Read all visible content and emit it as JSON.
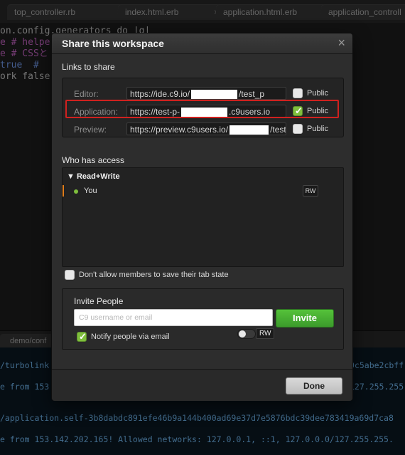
{
  "ide": {
    "tabs": [
      {
        "label": "top_controller.rb",
        "close": "×"
      },
      {
        "label": "index.html.erb",
        "close": "×"
      },
      {
        "label": "application.html.erb",
        "close": "×"
      },
      {
        "label": "application_controll",
        "close": ""
      }
    ],
    "code_lines": [
      "on.config.generators do |g|",
      "e # helpe",
      "e # CSSと",
      "true  #",
      "ork false"
    ],
    "terminal_tab": "demo/conf",
    "terminal_lines": [
      "/turbolink",
      "e from 153.",
      "/application.self-3b8dabdc891efe46b9a144b400ad69e37d7e5876bdc39dee783419a69d7ca8",
      "e from 153.142.202.165! Allowed networks: 127.0.0.1, ::1, 127.0.0.0/127.255.255."
    ],
    "terminal_right_fragments": [
      "0c5abe2cbff",
      "127.255.255."
    ]
  },
  "modal": {
    "title": "Share this workspace",
    "close": "×",
    "links_to_share": "Links to share",
    "links": [
      {
        "label": "Editor:",
        "url_prefix": "https://ide.c9.io/",
        "url_suffix": "/test_p",
        "public_label": "Public",
        "checked": false
      },
      {
        "label": "Application:",
        "url_prefix": "https://test-p-",
        "url_suffix": ".c9users.io",
        "public_label": "Public",
        "checked": true
      },
      {
        "label": "Preview:",
        "url_prefix": "https://preview.c9users.io/",
        "url_suffix": "/test",
        "public_label": "Public",
        "checked": false
      }
    ],
    "who_has_access": "Who has access",
    "access": {
      "role": "▼ Read+Write",
      "member": "You",
      "member_badge": "RW"
    },
    "dont_allow_label": "Don't allow members to save their tab state",
    "invite": {
      "title": "Invite People",
      "placeholder": "C9 username or email",
      "button": "Invite",
      "notify_label": "Notify people via email",
      "rw_label": "RW"
    },
    "done": "Done"
  },
  "colors": {
    "accent_green": "#7fbf3d",
    "highlight_red": "#d0211f",
    "modal_bg": "#2d2d2d"
  }
}
